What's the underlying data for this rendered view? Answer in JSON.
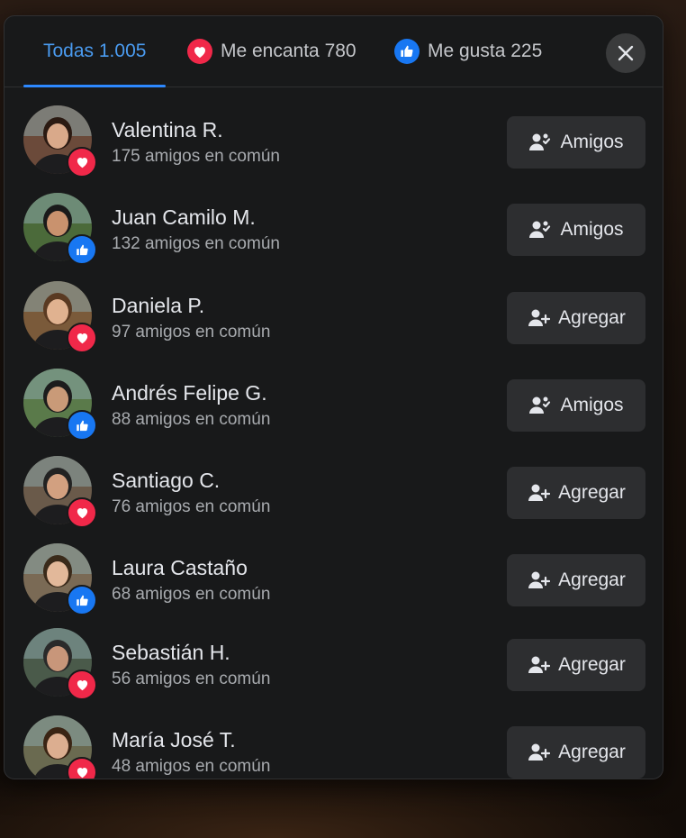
{
  "tabs": [
    {
      "label": "Todas 1.005",
      "active": true
    },
    {
      "label": "Me encanta 780",
      "reaction": "heart-icon"
    },
    {
      "label": "Me gusta 225",
      "reaction": "thumbs-up-icon"
    }
  ],
  "colors": {
    "love": "#f02849",
    "like": "#1877f2",
    "active_tab": "#2d88ff"
  },
  "people": [
    {
      "name": "Valentina R.",
      "mutual": "175 amigos en común",
      "reaction": "love",
      "action": "Amigos",
      "action_icon": "friends-icon"
    },
    {
      "name": "Juan Camilo M.",
      "mutual": "132 amigos en común",
      "reaction": "like",
      "action": "Amigos",
      "action_icon": "friends-icon"
    },
    {
      "name": "Daniela P.",
      "mutual": "97 amigos en común",
      "reaction": "love",
      "action": "Agregar",
      "action_icon": "add-friend-icon"
    },
    {
      "name": "Andrés Felipe G.",
      "mutual": "88 amigos en común",
      "reaction": "like",
      "action": "Amigos",
      "action_icon": "friends-icon"
    },
    {
      "name": "Santiago C.",
      "mutual": "76 amigos en común",
      "reaction": "love",
      "action": "Agregar",
      "action_icon": "add-friend-icon"
    },
    {
      "name": "Laura Castaño",
      "mutual": "68 amigos en común",
      "reaction": "like",
      "action": "Agregar",
      "action_icon": "add-friend-icon"
    },
    {
      "name": "Sebastián H.",
      "mutual": "56 amigos en común",
      "reaction": "love",
      "action": "Agregar",
      "action_icon": "add-friend-icon"
    },
    {
      "name": "María José T.",
      "mutual": "48 amigos en común",
      "reaction": "love",
      "action": "Agregar",
      "action_icon": "add-friend-icon"
    }
  ]
}
